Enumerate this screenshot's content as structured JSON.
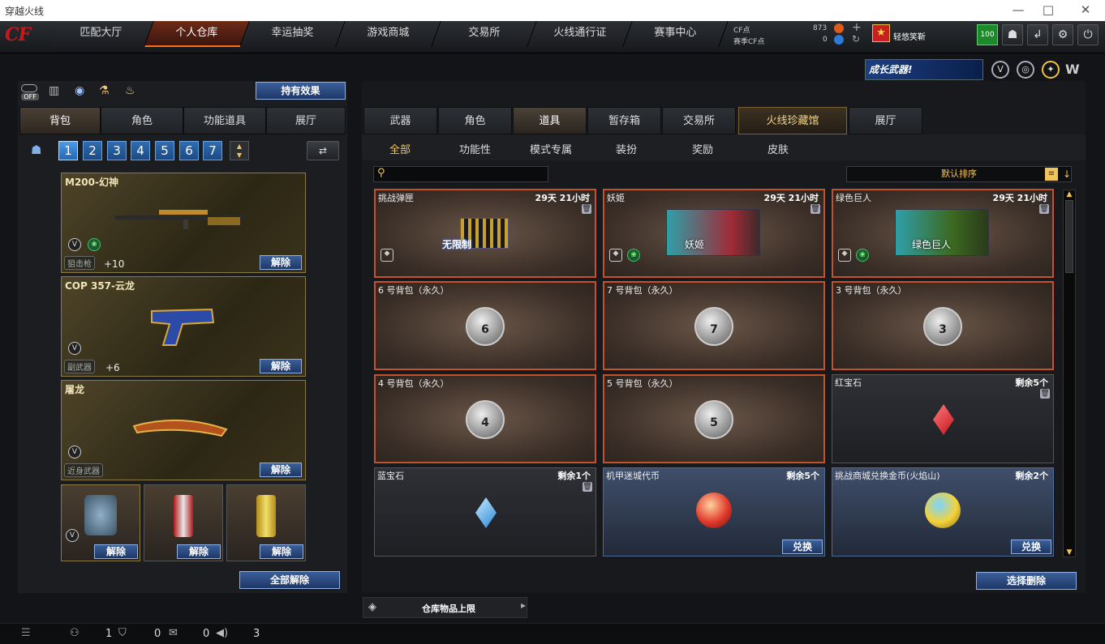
{
  "window": {
    "title": "穿越火线",
    "minimize": "—",
    "maximize": "□",
    "close": "✕"
  },
  "logo": "CF",
  "nav": [
    "匹配大厅",
    "个人仓库",
    "幸运抽奖",
    "游戏商城",
    "交易所",
    "火线通行证",
    "赛事中心"
  ],
  "currency": {
    "cf_label": "CF点",
    "cf_value": "873",
    "match_label": "赛季CF点",
    "match_value": "0"
  },
  "user": {
    "name": "轻悠笑靳",
    "level": "100"
  },
  "banner": "成长武器!",
  "left": {
    "off_label": "OFF",
    "effect_button": "持有效果",
    "tabs": [
      "背包",
      "角色",
      "功能道具",
      "展厅"
    ],
    "bags": [
      "1",
      "2",
      "3",
      "4",
      "5",
      "6",
      "7"
    ],
    "weapons": [
      {
        "name": "M200-幻神",
        "category": "狙击枪",
        "plus": "+10",
        "release": "解除"
      },
      {
        "name": "COP 357-云龙",
        "category": "副武器",
        "plus": "+6",
        "release": "解除"
      },
      {
        "name": "屠龙",
        "category": "近身武器",
        "plus": "",
        "release": "解除"
      }
    ],
    "small_release": [
      "解除",
      "解除",
      "解除"
    ],
    "release_all": "全部解除"
  },
  "right": {
    "tabs": [
      "武器",
      "角色",
      "道具",
      "暂存箱",
      "交易所",
      "火线珍藏馆",
      "展厅"
    ],
    "filters": [
      "全部",
      "功能性",
      "模式专属",
      "装扮",
      "奖励",
      "皮肤"
    ],
    "search_placeholder": "",
    "sort": "默认排序",
    "items": [
      {
        "name": "挑战弹匣",
        "time": "29天 21小时",
        "label": "无限制"
      },
      {
        "name": "妖姬",
        "time": "29天 21小时",
        "label": "妖姬"
      },
      {
        "name": "绿色巨人",
        "time": "29天 21小时",
        "label": "绿色巨人"
      },
      {
        "name": "6 号背包（永久）",
        "bag": "6"
      },
      {
        "name": "7 号背包（永久）",
        "bag": "7"
      },
      {
        "name": "3 号背包（永久）",
        "bag": "3"
      },
      {
        "name": "4 号背包（永久）",
        "bag": "4"
      },
      {
        "name": "5 号背包（永久）",
        "bag": "5"
      },
      {
        "name": "红宝石",
        "count": "剩余5个"
      },
      {
        "name": "蓝宝石",
        "count": "剩余1个"
      },
      {
        "name": "机甲迷城代币",
        "count": "剩余5个",
        "action": "兑换"
      },
      {
        "name": "挑战商城兑换金币(火焰山)",
        "count": "剩余2个",
        "action": "兑换"
      }
    ],
    "select_delete": "选择删除",
    "capacity": "仓库物品上限"
  },
  "status": {
    "v1": "1",
    "v2": "0",
    "v3": "0",
    "v4": "3"
  },
  "colors": {
    "accent": "#f1c45b",
    "rare_border": "#c4522a",
    "button_blue": "#2a4a82"
  }
}
